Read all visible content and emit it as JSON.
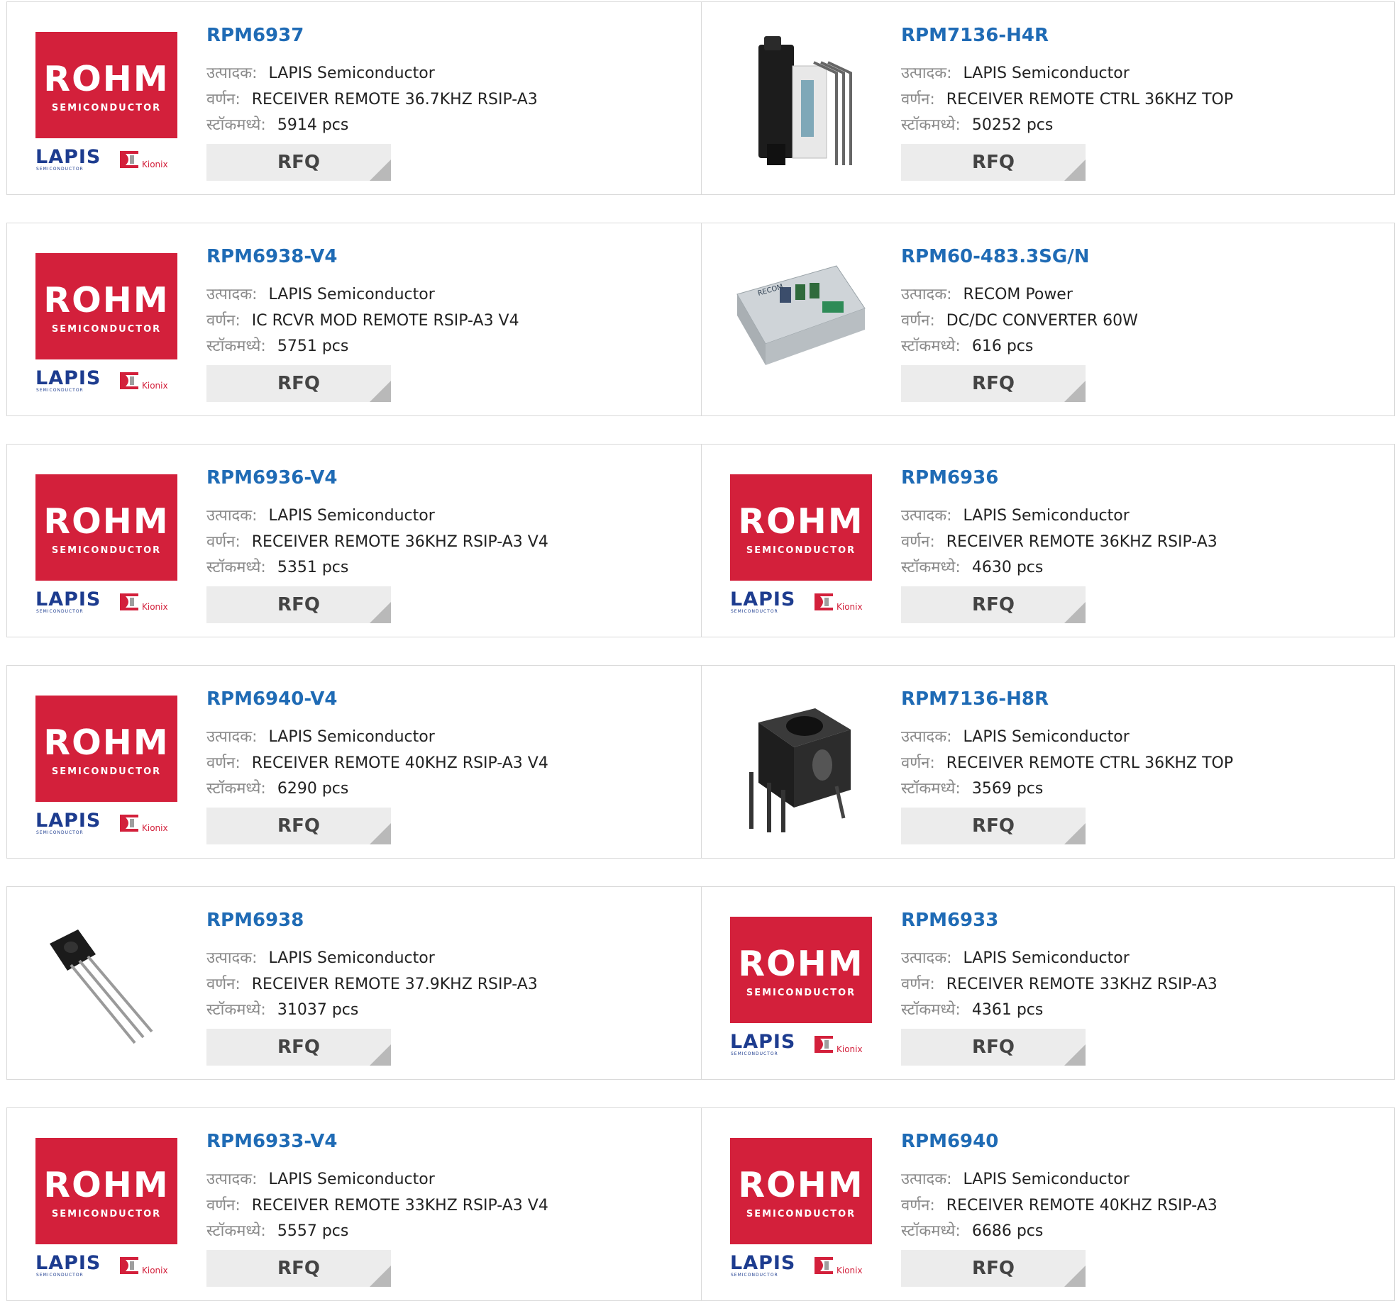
{
  "labels": {
    "manufacturer": "उत्पादक:",
    "description": "वर्णन:",
    "stock": "स्टॉकमध्ये:",
    "rfq": "RFQ"
  },
  "logo": {
    "rohm": "ROHM",
    "semiconductor": "SEMICONDUCTOR",
    "lapis": "LAPIS",
    "lapis_sub": "SEMICONDUCTOR",
    "kionix": "Kionix"
  },
  "colors": {
    "part_link": "#1f6bb5",
    "rohm_red": "#d3203b",
    "lapis_blue": "#1d3c8f",
    "rfq_bg": "#ececec"
  },
  "products": [
    {
      "name": "RPM6937",
      "manufacturer": "LAPIS Semiconductor",
      "description": "RECEIVER REMOTE 36.7KHZ RSIP-A3",
      "stock": "5914 pcs",
      "image": "rohm-lapis-logo"
    },
    {
      "name": "RPM7136-H4R",
      "manufacturer": "LAPIS Semiconductor",
      "description": "RECEIVER REMOTE CTRL 36KHZ TOP",
      "stock": "50252 pcs",
      "image": "ir-receiver-module-photo"
    },
    {
      "name": "RPM6938-V4",
      "manufacturer": "LAPIS Semiconductor",
      "description": "IC RCVR MOD REMOTE RSIP-A3 V4",
      "stock": "5751 pcs",
      "image": "rohm-lapis-logo"
    },
    {
      "name": "RPM60-483.3SG/N",
      "manufacturer": "RECOM Power",
      "description": "DC/DC CONVERTER 60W",
      "stock": "616 pcs",
      "image": "dc-dc-converter-photo"
    },
    {
      "name": "RPM6936-V4",
      "manufacturer": "LAPIS Semiconductor",
      "description": "RECEIVER REMOTE 36KHZ RSIP-A3 V4",
      "stock": "5351 pcs",
      "image": "rohm-lapis-logo"
    },
    {
      "name": "RPM6936",
      "manufacturer": "LAPIS Semiconductor",
      "description": "RECEIVER REMOTE 36KHZ RSIP-A3",
      "stock": "4630 pcs",
      "image": "rohm-lapis-logo"
    },
    {
      "name": "RPM6940-V4",
      "manufacturer": "LAPIS Semiconductor",
      "description": "RECEIVER REMOTE 40KHZ RSIP-A3 V4",
      "stock": "6290 pcs",
      "image": "rohm-lapis-logo"
    },
    {
      "name": "RPM7136-H8R",
      "manufacturer": "LAPIS Semiconductor",
      "description": "RECEIVER REMOTE CTRL 36KHZ TOP",
      "stock": "3569 pcs",
      "image": "ir-receiver-shield-photo"
    },
    {
      "name": "RPM6938",
      "manufacturer": "LAPIS Semiconductor",
      "description": "RECEIVER REMOTE 37.9KHZ RSIP-A3",
      "stock": "31037 pcs",
      "image": "ir-receiver-3pin-photo"
    },
    {
      "name": "RPM6933",
      "manufacturer": "LAPIS Semiconductor",
      "description": "RECEIVER REMOTE 33KHZ RSIP-A3",
      "stock": "4361 pcs",
      "image": "rohm-lapis-logo"
    },
    {
      "name": "RPM6933-V4",
      "manufacturer": "LAPIS Semiconductor",
      "description": "RECEIVER REMOTE 33KHZ RSIP-A3 V4",
      "stock": "5557 pcs",
      "image": "rohm-lapis-logo"
    },
    {
      "name": "RPM6940",
      "manufacturer": "LAPIS Semiconductor",
      "description": "RECEIVER REMOTE 40KHZ RSIP-A3",
      "stock": "6686 pcs",
      "image": "rohm-lapis-logo"
    }
  ]
}
